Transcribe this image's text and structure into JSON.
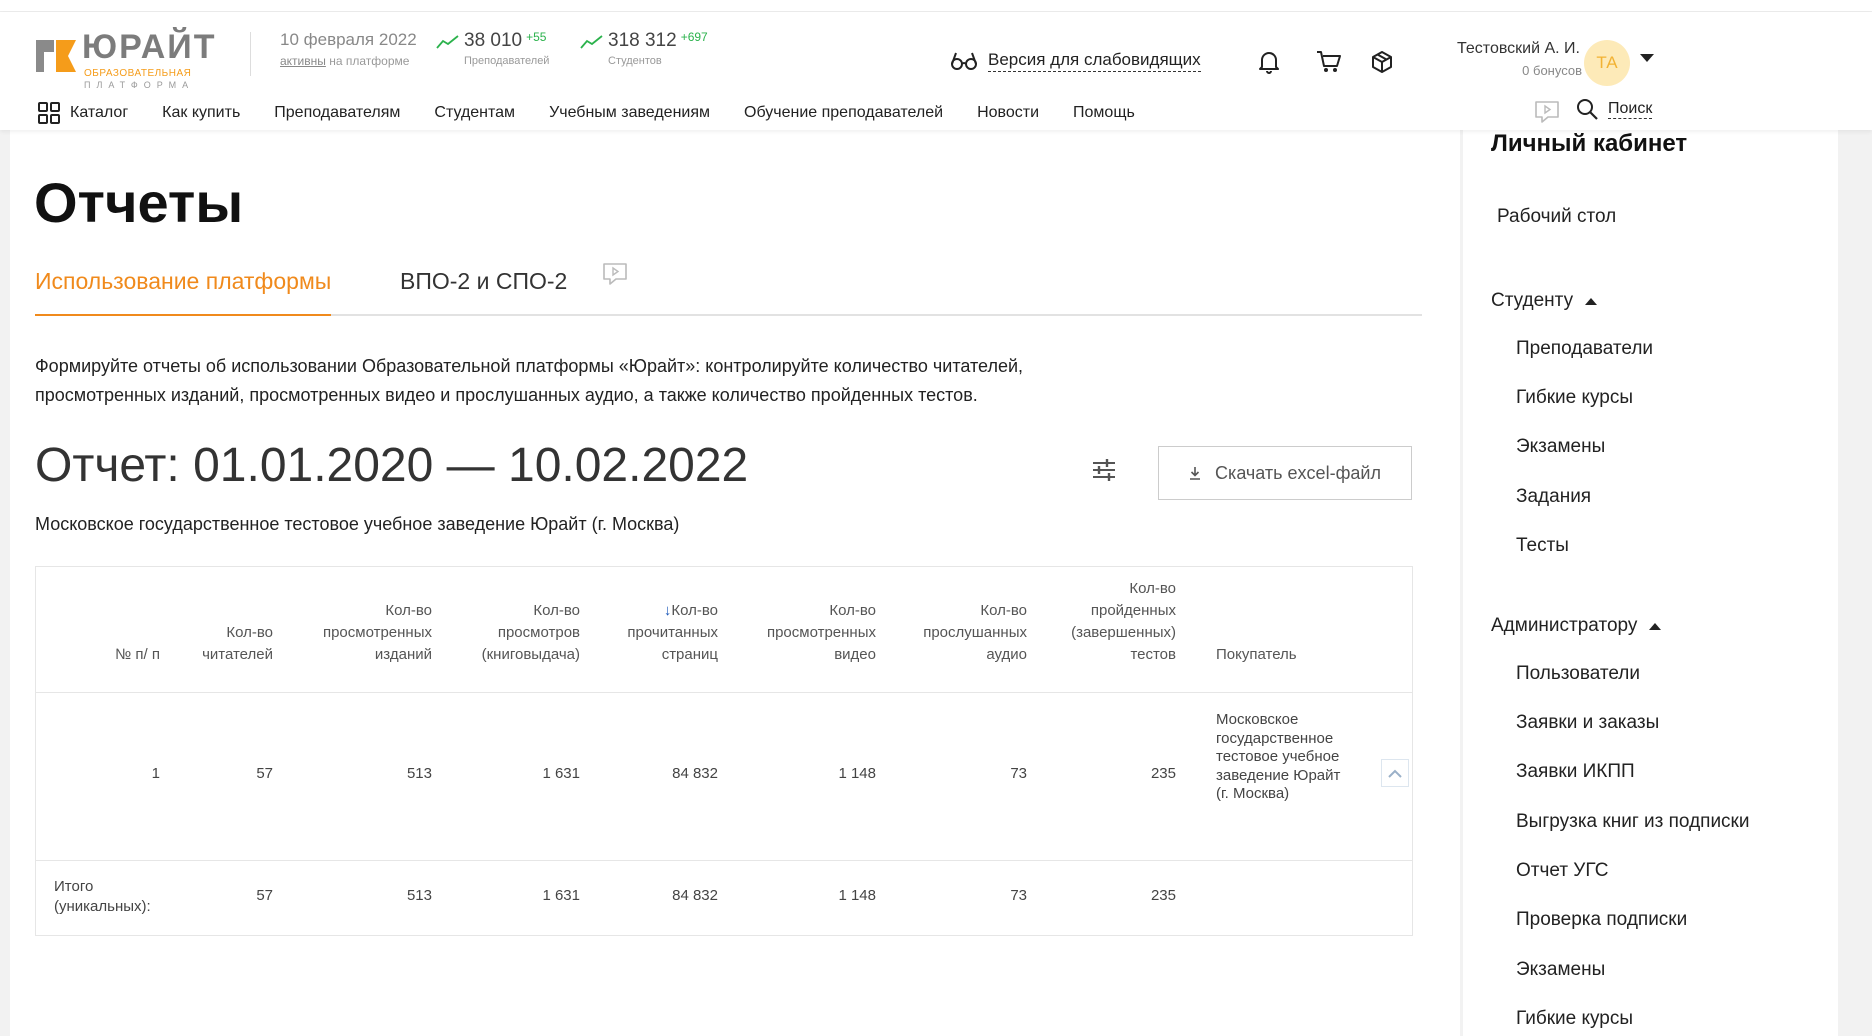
{
  "header": {
    "logo": {
      "name": "ЮРАЙТ",
      "sub1": "ОБРАЗОВАТЕЛЬНАЯ",
      "sub2": "ПЛАТФОРМА"
    },
    "date": "10 февраля 2022",
    "active_link": "активны",
    "active_suffix": "на платформе",
    "teachers": {
      "value": "38 010",
      "delta": "+55",
      "label": "Преподавателей"
    },
    "students": {
      "value": "318 312",
      "delta": "+697",
      "label": "Студентов"
    },
    "low_vision_label": "Версия для слабовидящих",
    "user": {
      "name": "Тестовский А. И.",
      "bonus": "0 бонусов",
      "initials": "ТА"
    },
    "search_label": "Поиск"
  },
  "nav": {
    "items": [
      {
        "label": "Каталог"
      },
      {
        "label": "Как купить"
      },
      {
        "label": "Преподавателям"
      },
      {
        "label": "Студентам"
      },
      {
        "label": "Учебным заведениям"
      },
      {
        "label": "Обучение преподавателей"
      },
      {
        "label": "Новости"
      },
      {
        "label": "Помощь"
      }
    ]
  },
  "main": {
    "title": "Отчеты",
    "tabs": [
      {
        "label": "Использование платформы",
        "active": true
      },
      {
        "label": "ВПО-2 и СПО-2",
        "active": false
      }
    ],
    "description": "Формируйте отчеты об использовании Образовательной платформы «Юрайт»: контролируйте количество читателей, просмотренных изданий, просмотренных видео и прослушанных аудио, а также количество пройденных тестов.",
    "report_title": "Отчет: 01.01.2020 — 10.02.2022",
    "download_label": "Скачать excel-файл",
    "organization": "Московское государственное тестовое учебное заведение Юрайт (г. Москва)",
    "table": {
      "headers": {
        "num": "№ п/ п",
        "readers": "Кол-во читателей",
        "editions": "Кол-во просмотренных изданий",
        "views": "Кол-во просмотров (книговыдача)",
        "pages": "Кол-во прочитанных страниц",
        "videos": "Кол-во просмотренных видео",
        "audio": "Кол-во прослушанных аудио",
        "tests": "Кол-во пройденных (завершенных) тестов",
        "buyer": "Покупатель"
      },
      "row": {
        "num": "1",
        "readers": "57",
        "editions": "513",
        "views": "1 631",
        "pages": "84 832",
        "videos": "1 148",
        "audio": "73",
        "tests": "235",
        "buyer": "Московское государственное тестовое учебное заведение Юрайт (г. Москва)"
      },
      "total": {
        "label": "Итого (уникальных):",
        "readers": "57",
        "editions": "513",
        "views": "1 631",
        "pages": "84 832",
        "videos": "1 148",
        "audio": "73",
        "tests": "235"
      }
    }
  },
  "sidebar": {
    "title": "Личный кабинет",
    "desk": "Рабочий стол",
    "student_section": "Студенту",
    "student_items": [
      {
        "label": "Преподаватели"
      },
      {
        "label": "Гибкие курсы"
      },
      {
        "label": "Экзамены"
      },
      {
        "label": "Задания"
      },
      {
        "label": "Тесты"
      }
    ],
    "admin_section": "Администратору",
    "admin_items": [
      {
        "label": "Пользователи"
      },
      {
        "label": "Заявки и заказы"
      },
      {
        "label": "Заявки ИКПП"
      },
      {
        "label": "Выгрузка книг из подписки"
      },
      {
        "label": "Отчет УГС"
      },
      {
        "label": "Проверка подписки"
      },
      {
        "label": "Экзамены"
      },
      {
        "label": "Гибкие курсы"
      }
    ]
  },
  "colors": {
    "accent": "#f08a1c",
    "positive": "#2bb24c",
    "sort_arrow": "#1a57b8"
  }
}
